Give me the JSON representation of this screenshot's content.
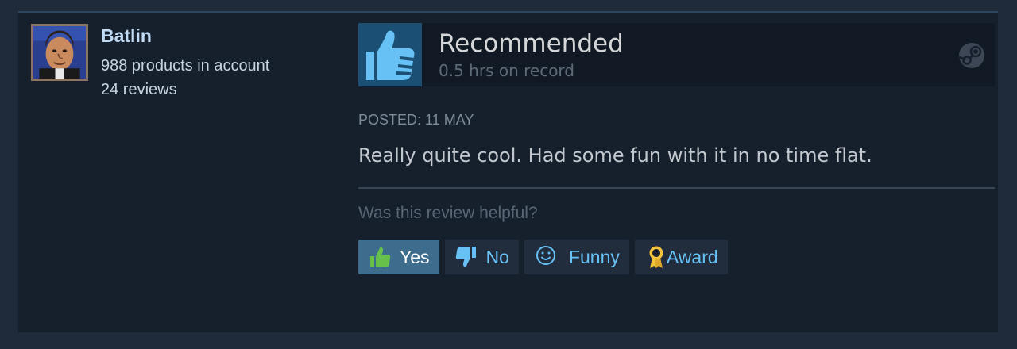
{
  "author": {
    "name": "Batlin",
    "products": "988 products in account",
    "reviews": "24 reviews"
  },
  "review": {
    "verdict": "Recommended",
    "hours": "0.5 hrs on record",
    "posted": "POSTED: 11 MAY",
    "text": "Really quite cool. Had some fun with it in no time flat.",
    "helpful_question": "Was this review helpful?"
  },
  "votes": {
    "yes_label": "Yes",
    "no_label": "No",
    "funny_label": "Funny",
    "award_label": "Award",
    "selected": "Yes"
  },
  "icons": {
    "verdict": "thumbs-up-icon",
    "platform": "steam-logo-icon",
    "yes": "thumbs-up-icon",
    "no": "thumbs-down-icon",
    "funny": "smiley-icon",
    "award": "award-ribbon-icon"
  },
  "colors": {
    "accent": "#67c1f5",
    "author_name": "#c1dbf4",
    "active_button": "#3d6c8d",
    "thumb_tile": "#1b4f73",
    "thumb_up_green": "#66c04a",
    "award_gold": "#f3c33b"
  }
}
